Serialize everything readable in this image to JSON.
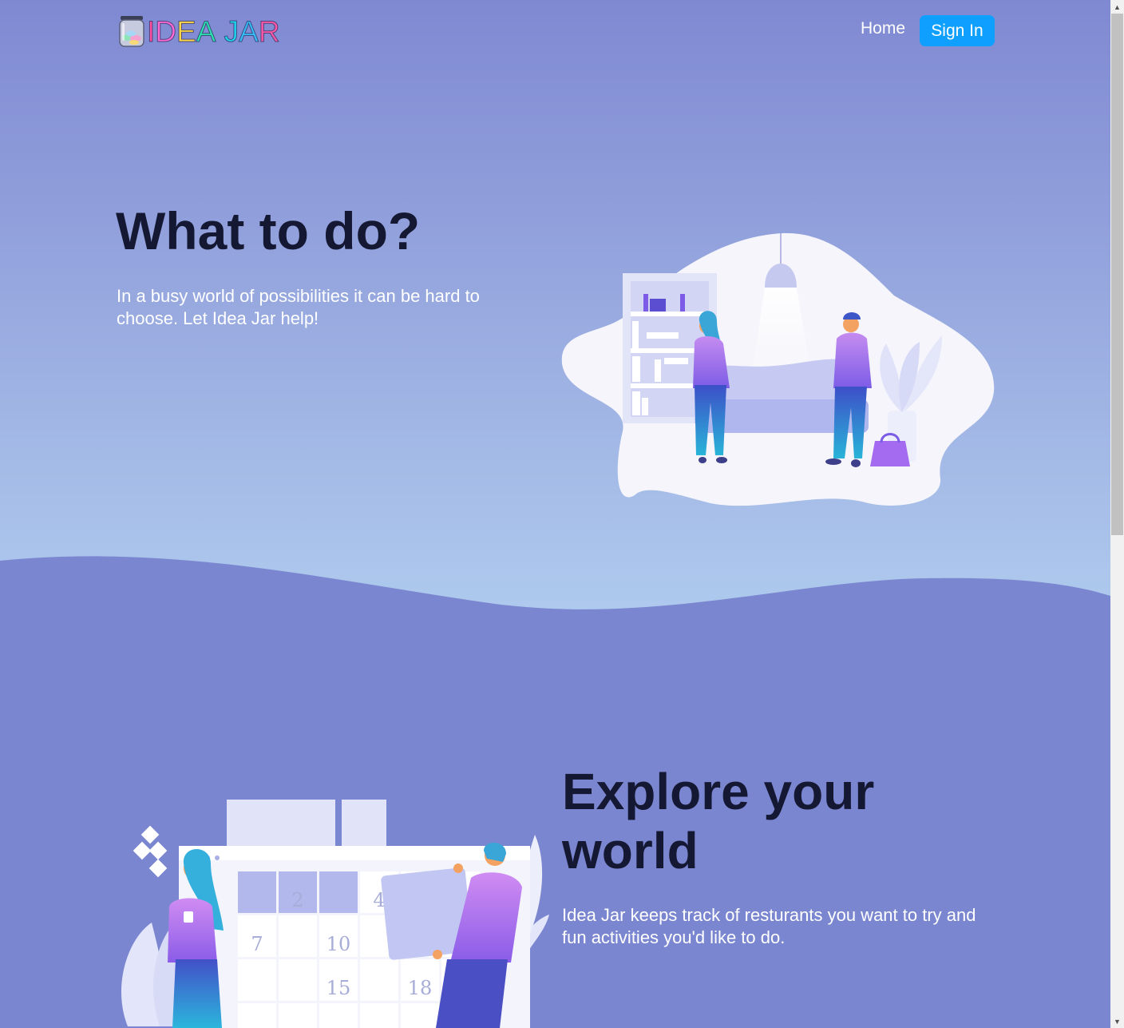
{
  "header": {
    "logo_letters": [
      {
        "char": "I",
        "color": "#ff4fa0"
      },
      {
        "char": "D",
        "color": "#ff6ad5"
      },
      {
        "char": "E",
        "color": "#ffd84a"
      },
      {
        "char": "A",
        "color": "#2de0b0"
      },
      {
        "char": " ",
        "color": "#ffffff"
      },
      {
        "char": "J",
        "color": "#22d3ee"
      },
      {
        "char": "A",
        "color": "#38bdf8"
      },
      {
        "char": "R",
        "color": "#ff5aa8"
      }
    ],
    "nav_home": "Home",
    "nav_signin": "Sign In"
  },
  "hero": {
    "title": "What to do?",
    "text": "In a busy world of possibilities it can be hard to choose. Let Idea Jar help!"
  },
  "explore": {
    "title": "Explore your world",
    "text": "Idea Jar keeps track of resturants you want to try and fun activities you'd like to do."
  },
  "calendar_numbers": [
    "2",
    "4",
    "7",
    "10",
    "15",
    "18"
  ],
  "colors": {
    "accent": "#0fa0ff",
    "heading": "#151833",
    "section_bg": "#7b86d0"
  },
  "icons": [
    "jar-logo-icon",
    "scroll-up-arrow-icon",
    "scroll-down-arrow-icon"
  ]
}
